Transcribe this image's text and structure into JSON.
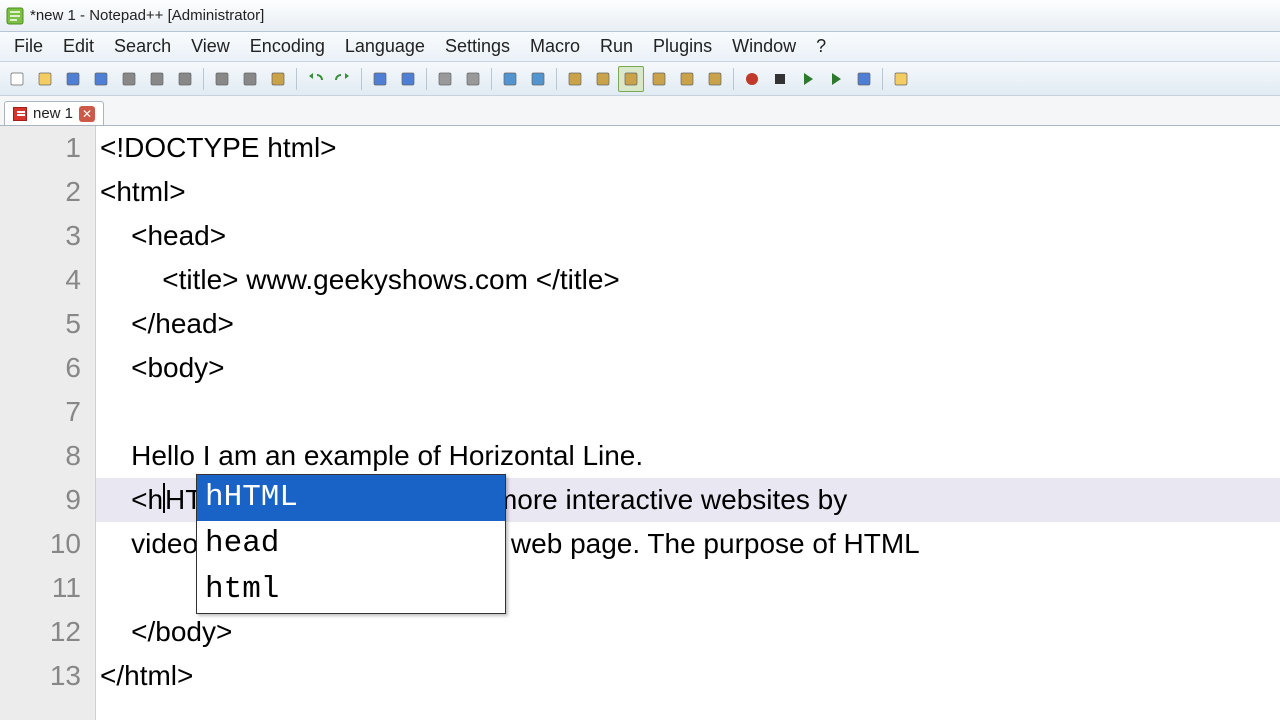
{
  "window": {
    "title": "*new 1 - Notepad++ [Administrator]"
  },
  "menu": [
    "File",
    "Edit",
    "Search",
    "View",
    "Encoding",
    "Language",
    "Settings",
    "Macro",
    "Run",
    "Plugins",
    "Window",
    "?"
  ],
  "toolbar_icons": [
    "new-file-icon",
    "open-file-icon",
    "save-icon",
    "save-all-icon",
    "close-icon",
    "close-all-icon",
    "print-icon",
    "|",
    "cut-icon",
    "copy-icon",
    "paste-icon",
    "|",
    "undo-icon",
    "redo-icon",
    "|",
    "find-icon",
    "replace-icon",
    "|",
    "zoom-in-icon",
    "zoom-out-icon",
    "|",
    "sync-v-icon",
    "sync-h-icon",
    "|",
    "wrap-icon",
    "show-all-icon",
    "indent-guide-icon",
    "lang-icon",
    "doc-map-icon",
    "func-list-icon",
    "|",
    "record-macro-icon",
    "stop-macro-icon",
    "play-macro-icon",
    "play-multi-icon",
    "save-macro-icon",
    "|",
    "folder-icon"
  ],
  "toolbar_active": "indent-guide-icon",
  "tab": {
    "label": "new 1",
    "modified": true
  },
  "editor": {
    "current_line": 9,
    "lines": [
      "<!DOCTYPE html>",
      "<html>",
      "    <head>",
      "        <title> www.geekyshows.com </title>",
      "    </head>",
      "    <body>",
      "",
      "    Hello I am an example of Horizontal Line.",
      "    <hHTML 5 enables to create more interactive websites by",
      "    videos, and animations on the web page. The purpose of HTML",
      "",
      "    </body>",
      "</html>"
    ]
  },
  "autocomplete": {
    "items": [
      "hHTML",
      "head",
      "html"
    ],
    "selected_index": 0
  }
}
